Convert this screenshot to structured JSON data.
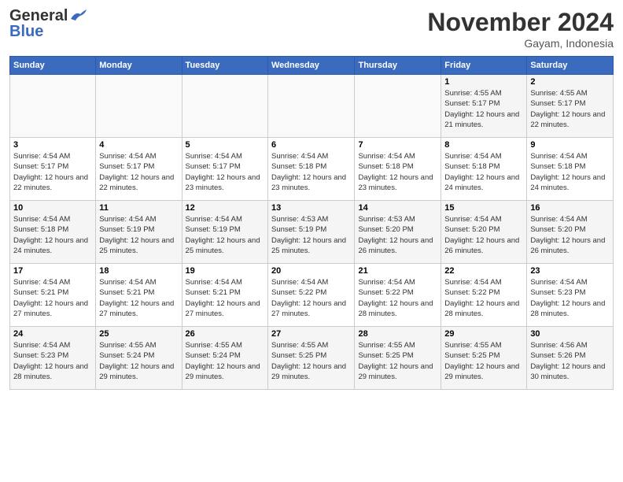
{
  "header": {
    "logo": {
      "text_general": "General",
      "text_blue": "Blue"
    },
    "title": "November 2024",
    "location": "Gayam, Indonesia"
  },
  "weekdays": [
    "Sunday",
    "Monday",
    "Tuesday",
    "Wednesday",
    "Thursday",
    "Friday",
    "Saturday"
  ],
  "weeks": [
    [
      {
        "day": "",
        "sunrise": "",
        "sunset": "",
        "daylight": ""
      },
      {
        "day": "",
        "sunrise": "",
        "sunset": "",
        "daylight": ""
      },
      {
        "day": "",
        "sunrise": "",
        "sunset": "",
        "daylight": ""
      },
      {
        "day": "",
        "sunrise": "",
        "sunset": "",
        "daylight": ""
      },
      {
        "day": "",
        "sunrise": "",
        "sunset": "",
        "daylight": ""
      },
      {
        "day": "1",
        "sunrise": "Sunrise: 4:55 AM",
        "sunset": "Sunset: 5:17 PM",
        "daylight": "Daylight: 12 hours and 21 minutes."
      },
      {
        "day": "2",
        "sunrise": "Sunrise: 4:55 AM",
        "sunset": "Sunset: 5:17 PM",
        "daylight": "Daylight: 12 hours and 22 minutes."
      }
    ],
    [
      {
        "day": "3",
        "sunrise": "Sunrise: 4:54 AM",
        "sunset": "Sunset: 5:17 PM",
        "daylight": "Daylight: 12 hours and 22 minutes."
      },
      {
        "day": "4",
        "sunrise": "Sunrise: 4:54 AM",
        "sunset": "Sunset: 5:17 PM",
        "daylight": "Daylight: 12 hours and 22 minutes."
      },
      {
        "day": "5",
        "sunrise": "Sunrise: 4:54 AM",
        "sunset": "Sunset: 5:17 PM",
        "daylight": "Daylight: 12 hours and 23 minutes."
      },
      {
        "day": "6",
        "sunrise": "Sunrise: 4:54 AM",
        "sunset": "Sunset: 5:18 PM",
        "daylight": "Daylight: 12 hours and 23 minutes."
      },
      {
        "day": "7",
        "sunrise": "Sunrise: 4:54 AM",
        "sunset": "Sunset: 5:18 PM",
        "daylight": "Daylight: 12 hours and 23 minutes."
      },
      {
        "day": "8",
        "sunrise": "Sunrise: 4:54 AM",
        "sunset": "Sunset: 5:18 PM",
        "daylight": "Daylight: 12 hours and 24 minutes."
      },
      {
        "day": "9",
        "sunrise": "Sunrise: 4:54 AM",
        "sunset": "Sunset: 5:18 PM",
        "daylight": "Daylight: 12 hours and 24 minutes."
      }
    ],
    [
      {
        "day": "10",
        "sunrise": "Sunrise: 4:54 AM",
        "sunset": "Sunset: 5:18 PM",
        "daylight": "Daylight: 12 hours and 24 minutes."
      },
      {
        "day": "11",
        "sunrise": "Sunrise: 4:54 AM",
        "sunset": "Sunset: 5:19 PM",
        "daylight": "Daylight: 12 hours and 25 minutes."
      },
      {
        "day": "12",
        "sunrise": "Sunrise: 4:54 AM",
        "sunset": "Sunset: 5:19 PM",
        "daylight": "Daylight: 12 hours and 25 minutes."
      },
      {
        "day": "13",
        "sunrise": "Sunrise: 4:53 AM",
        "sunset": "Sunset: 5:19 PM",
        "daylight": "Daylight: 12 hours and 25 minutes."
      },
      {
        "day": "14",
        "sunrise": "Sunrise: 4:53 AM",
        "sunset": "Sunset: 5:20 PM",
        "daylight": "Daylight: 12 hours and 26 minutes."
      },
      {
        "day": "15",
        "sunrise": "Sunrise: 4:54 AM",
        "sunset": "Sunset: 5:20 PM",
        "daylight": "Daylight: 12 hours and 26 minutes."
      },
      {
        "day": "16",
        "sunrise": "Sunrise: 4:54 AM",
        "sunset": "Sunset: 5:20 PM",
        "daylight": "Daylight: 12 hours and 26 minutes."
      }
    ],
    [
      {
        "day": "17",
        "sunrise": "Sunrise: 4:54 AM",
        "sunset": "Sunset: 5:21 PM",
        "daylight": "Daylight: 12 hours and 27 minutes."
      },
      {
        "day": "18",
        "sunrise": "Sunrise: 4:54 AM",
        "sunset": "Sunset: 5:21 PM",
        "daylight": "Daylight: 12 hours and 27 minutes."
      },
      {
        "day": "19",
        "sunrise": "Sunrise: 4:54 AM",
        "sunset": "Sunset: 5:21 PM",
        "daylight": "Daylight: 12 hours and 27 minutes."
      },
      {
        "day": "20",
        "sunrise": "Sunrise: 4:54 AM",
        "sunset": "Sunset: 5:22 PM",
        "daylight": "Daylight: 12 hours and 27 minutes."
      },
      {
        "day": "21",
        "sunrise": "Sunrise: 4:54 AM",
        "sunset": "Sunset: 5:22 PM",
        "daylight": "Daylight: 12 hours and 28 minutes."
      },
      {
        "day": "22",
        "sunrise": "Sunrise: 4:54 AM",
        "sunset": "Sunset: 5:22 PM",
        "daylight": "Daylight: 12 hours and 28 minutes."
      },
      {
        "day": "23",
        "sunrise": "Sunrise: 4:54 AM",
        "sunset": "Sunset: 5:23 PM",
        "daylight": "Daylight: 12 hours and 28 minutes."
      }
    ],
    [
      {
        "day": "24",
        "sunrise": "Sunrise: 4:54 AM",
        "sunset": "Sunset: 5:23 PM",
        "daylight": "Daylight: 12 hours and 28 minutes."
      },
      {
        "day": "25",
        "sunrise": "Sunrise: 4:55 AM",
        "sunset": "Sunset: 5:24 PM",
        "daylight": "Daylight: 12 hours and 29 minutes."
      },
      {
        "day": "26",
        "sunrise": "Sunrise: 4:55 AM",
        "sunset": "Sunset: 5:24 PM",
        "daylight": "Daylight: 12 hours and 29 minutes."
      },
      {
        "day": "27",
        "sunrise": "Sunrise: 4:55 AM",
        "sunset": "Sunset: 5:25 PM",
        "daylight": "Daylight: 12 hours and 29 minutes."
      },
      {
        "day": "28",
        "sunrise": "Sunrise: 4:55 AM",
        "sunset": "Sunset: 5:25 PM",
        "daylight": "Daylight: 12 hours and 29 minutes."
      },
      {
        "day": "29",
        "sunrise": "Sunrise: 4:55 AM",
        "sunset": "Sunset: 5:25 PM",
        "daylight": "Daylight: 12 hours and 29 minutes."
      },
      {
        "day": "30",
        "sunrise": "Sunrise: 4:56 AM",
        "sunset": "Sunset: 5:26 PM",
        "daylight": "Daylight: 12 hours and 30 minutes."
      }
    ]
  ]
}
